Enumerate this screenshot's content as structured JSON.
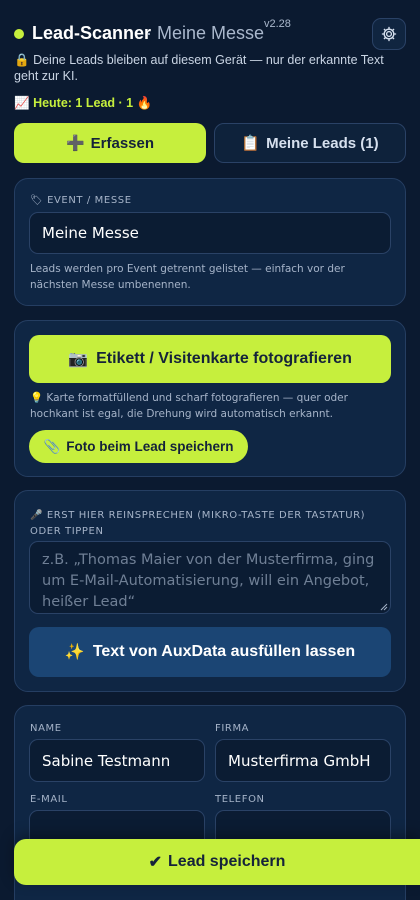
{
  "header": {
    "title": "Lead-Scanner",
    "event_subtitle": "· Meine Messe",
    "version": "v2.28",
    "settings_icon": "gear-icon"
  },
  "privacy_note": {
    "icon": "🔒",
    "text": "Deine Leads bleiben auf diesem Gerät — nur der erkannte Text geht zur KI."
  },
  "today": {
    "icon": "📈",
    "text": "Heute: 1 Lead · 1",
    "fire_icon": "🔥"
  },
  "tabs": [
    {
      "icon": "➕",
      "label": "Erfassen"
    },
    {
      "icon": "📋",
      "label": "Meine Leads (1)"
    }
  ],
  "event_card": {
    "label_icon": "🏷",
    "label": "EVENT / MESSE",
    "value": "Meine Messe",
    "hint": "Leads werden pro Event getrennt gelistet — einfach vor der nächsten Messe umbenennen."
  },
  "photo_card": {
    "button_icon": "📷",
    "button_label": "Etikett / Visitenkarte fotografieren",
    "hint_icon": "💡",
    "hint": "Karte formatfüllend und scharf fotografieren — quer oder hochkant ist egal, die Drehung wird automatisch erkannt.",
    "toggle_icon": "📎",
    "toggle_label": "Foto beim Lead speichern"
  },
  "dictate_card": {
    "label_icon": "🎤",
    "label": "ERST HIER REINSPRECHEN (MIKRO-TASTE DER TASTATUR) ODER TIPPEN",
    "placeholder": "z.B. „Thomas Maier von der Musterfirma, ging um E-Mail-Automatisierung, will ein Angebot, heißer Lead“",
    "ai_button_icon": "✨",
    "ai_button_label": "Text von AuxData ausfüllen lassen"
  },
  "form": {
    "name_label": "NAME",
    "name_value": "Sabine Testmann",
    "company_label": "FIRMA",
    "company_value": "Musterfirma GmbH",
    "email_label": "E-MAIL",
    "email_value": "",
    "phone_label": "TELEFON",
    "phone_value": ""
  },
  "save_button": {
    "icon": "✔",
    "label": "Lead speichern"
  },
  "colors": {
    "accent": "#c6ef3d",
    "background": "#0b1a30",
    "card": "#0f2644",
    "secondary_button": "#1b4574"
  }
}
